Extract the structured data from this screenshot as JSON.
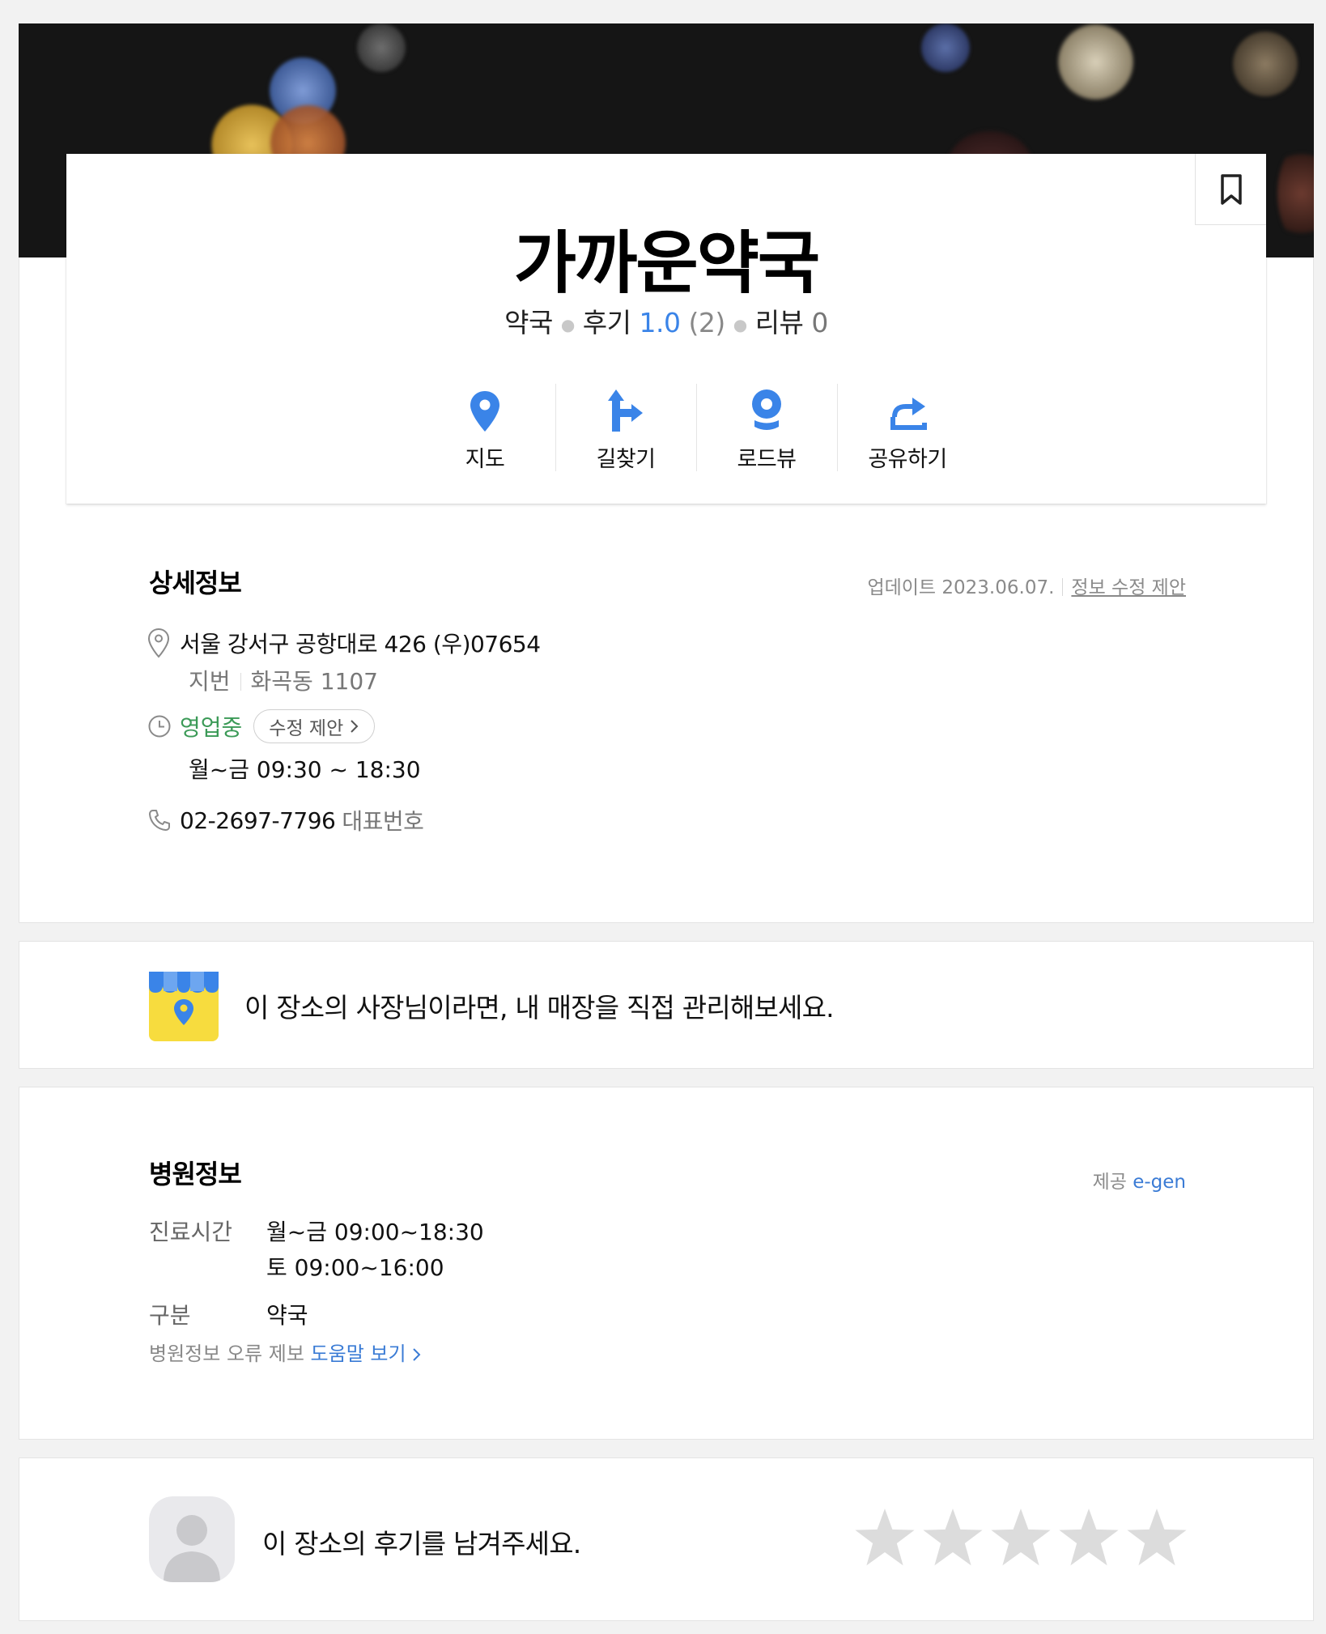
{
  "place": {
    "name": "가까운약국",
    "category": "약국",
    "review_label": "후기",
    "score": "1.0",
    "score_count": "(2)",
    "blog_review_label": "리뷰",
    "blog_review_count": "0"
  },
  "actions": [
    {
      "label": "지도",
      "icon": "map-pin-icon"
    },
    {
      "label": "길찾기",
      "icon": "directions-icon"
    },
    {
      "label": "로드뷰",
      "icon": "roadview-icon"
    },
    {
      "label": "공유하기",
      "icon": "share-icon"
    }
  ],
  "detail": {
    "title": "상세정보",
    "updated": "업데이트 2023.06.07.",
    "suggest_link": "정보 수정 제안",
    "address": "서울 강서구 공항대로 426 (우)07654",
    "jibun_label": "지번",
    "jibun": "화곡동 1107",
    "status": "영업중",
    "status_suggest": "수정 제안",
    "hours": "월~금  09:30 ~ 18:30",
    "phone": "02-2697-7796",
    "phone_label": "대표번호"
  },
  "owner": {
    "text": "이 장소의 사장님이라면, 내 매장을 직접 관리해보세요."
  },
  "hospital": {
    "title": "병원정보",
    "provider_label": "제공",
    "provider": "e-gen",
    "hours_label": "진료시간",
    "hours_line1": "월~금 09:00~18:30",
    "hours_line2": "토 09:00~16:00",
    "type_label": "구분",
    "type": "약국",
    "report_text": "병원정보 오류 제보",
    "help_link": "도움말 보기"
  },
  "review": {
    "prompt": "이 장소의 후기를 남겨주세요.",
    "rating": 0,
    "max_rating": 5
  },
  "colors": {
    "accent": "#3a84e8",
    "open": "#3b9a57",
    "star_empty": "#dcdcdc"
  }
}
